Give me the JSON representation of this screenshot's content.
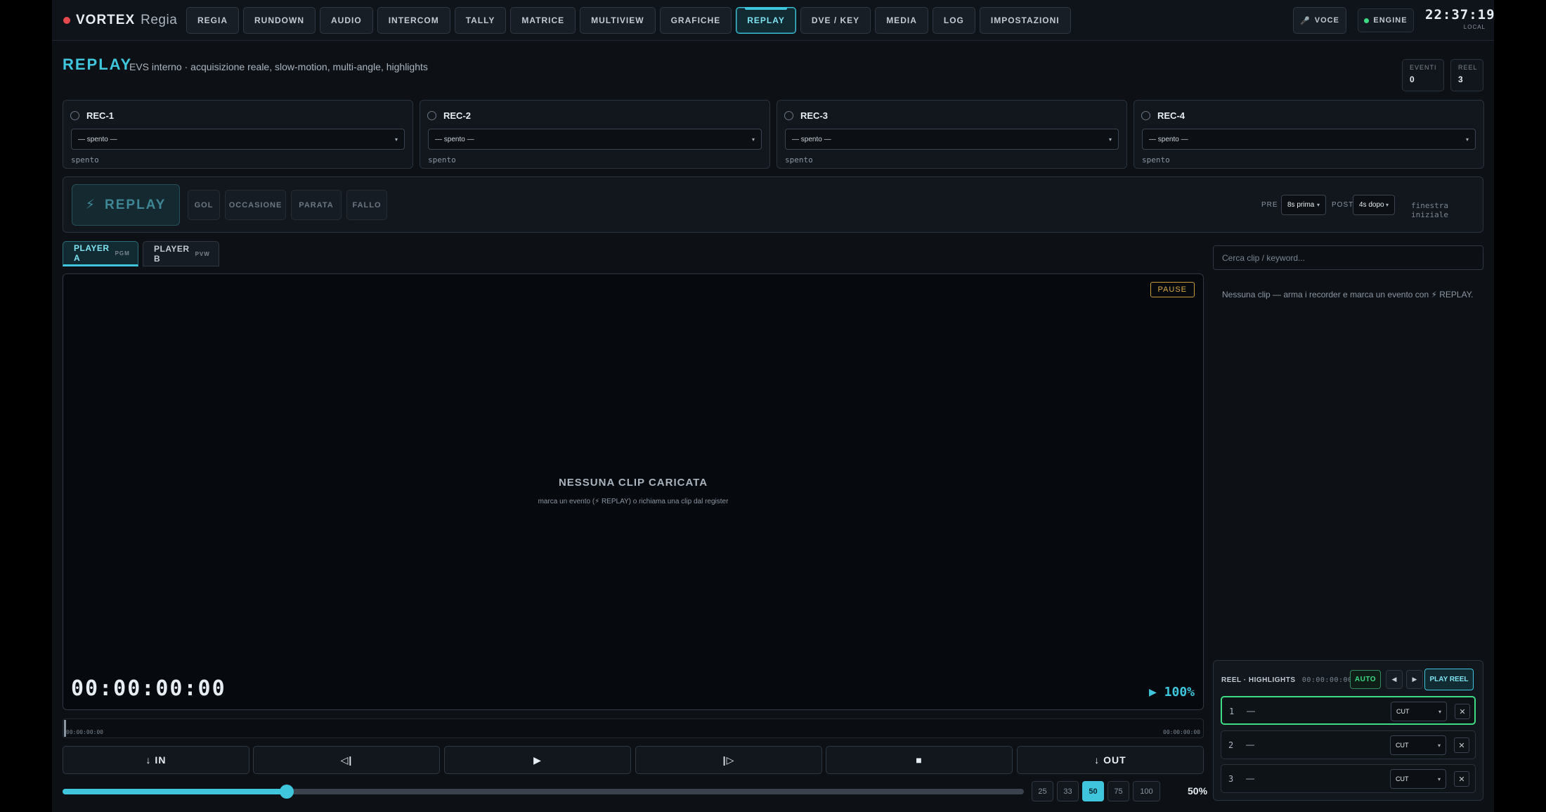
{
  "header": {
    "brand_name": "VORTEX",
    "brand_sub": "Regia",
    "tabs": [
      {
        "label": "REGIA"
      },
      {
        "label": "RUNDOWN"
      },
      {
        "label": "AUDIO"
      },
      {
        "label": "INTERCOM"
      },
      {
        "label": "TALLY"
      },
      {
        "label": "MATRICE"
      },
      {
        "label": "MULTIVIEW"
      },
      {
        "label": "GRAFICHE"
      },
      {
        "label": "REPLAY"
      },
      {
        "label": "DVE / KEY"
      },
      {
        "label": "MEDIA"
      },
      {
        "label": "LOG"
      },
      {
        "label": "IMPOSTAZIONI"
      }
    ],
    "active_tab": "REPLAY",
    "voce_label": "VOCE",
    "engine_label": "ENGINE",
    "clock_time": "22:37:19",
    "clock_zone": "LOCAL"
  },
  "page": {
    "title": "REPLAY",
    "subtitle": "EVS interno · acquisizione reale, slow-motion, multi-angle, highlights",
    "stats": [
      {
        "label": "EVENTI",
        "value": "0"
      },
      {
        "label": "REEL",
        "value": "3"
      }
    ]
  },
  "recorders": [
    {
      "name": "REC-1",
      "source": "— spento —",
      "status": "spento"
    },
    {
      "name": "REC-2",
      "source": "— spento —",
      "status": "spento"
    },
    {
      "name": "REC-3",
      "source": "— spento —",
      "status": "spento"
    },
    {
      "name": "REC-4",
      "source": "— spento —",
      "status": "spento"
    }
  ],
  "replay_bar": {
    "replay_icon": "⚡",
    "replay_label": "REPLAY",
    "events": [
      {
        "label": "GOL"
      },
      {
        "label": "OCCASIONE"
      },
      {
        "label": "PARATA"
      },
      {
        "label": "FALLO"
      }
    ],
    "pre_label": "PRE",
    "pre_value": "8s prima",
    "post_label": "POST",
    "post_value": "4s dopo",
    "window_note": "finestra iniziale"
  },
  "players": [
    {
      "label": "PLAYER A",
      "tag": "PGM"
    },
    {
      "label": "PLAYER B",
      "tag": "PVW"
    }
  ],
  "player": {
    "state": "PAUSE",
    "empty_title": "NESSUNA CLIP CARICATA",
    "empty_sub": "marca un evento (⚡ REPLAY) o richiama una clip dal register",
    "timecode": "00:00:00:00",
    "speed_readout": "▶ 100%",
    "timeline_start": "00:00:00:00",
    "timeline_end": "00:00:00:00"
  },
  "transport": [
    {
      "label": "↓ IN"
    },
    {
      "label": "◁|"
    },
    {
      "label": "▶"
    },
    {
      "label": "|▷"
    },
    {
      "label": "■"
    },
    {
      "label": "↓ OUT"
    }
  ],
  "speed": {
    "value": 0.5,
    "readout": "50%",
    "presets": [
      {
        "label": "25"
      },
      {
        "label": "33"
      },
      {
        "label": "50"
      },
      {
        "label": "75"
      },
      {
        "label": "100"
      }
    ],
    "active_preset": "50"
  },
  "clips": {
    "search_placeholder": "Cerca clip / keyword...",
    "empty_message": "Nessuna clip — arma i recorder e marca un evento con ⚡ REPLAY."
  },
  "reel": {
    "title": "REEL · HIGHLIGHTS",
    "duration": "00:00:00:00",
    "auto_label": "AUTO",
    "prev_label": "◀",
    "next_label": "▶",
    "play_label": "PLAY REEL",
    "rows": [
      {
        "index": "1",
        "clip": "—",
        "transition": "CUT",
        "remove": "✕"
      },
      {
        "index": "2",
        "clip": "—",
        "transition": "CUT",
        "remove": "✕"
      },
      {
        "index": "3",
        "clip": "—",
        "transition": "CUT",
        "remove": "✕"
      }
    ]
  },
  "colors": {
    "accent": "#3fc6dc",
    "ok": "#3ddc84",
    "warn": "#d8aa48",
    "rec": "#e5484d"
  }
}
